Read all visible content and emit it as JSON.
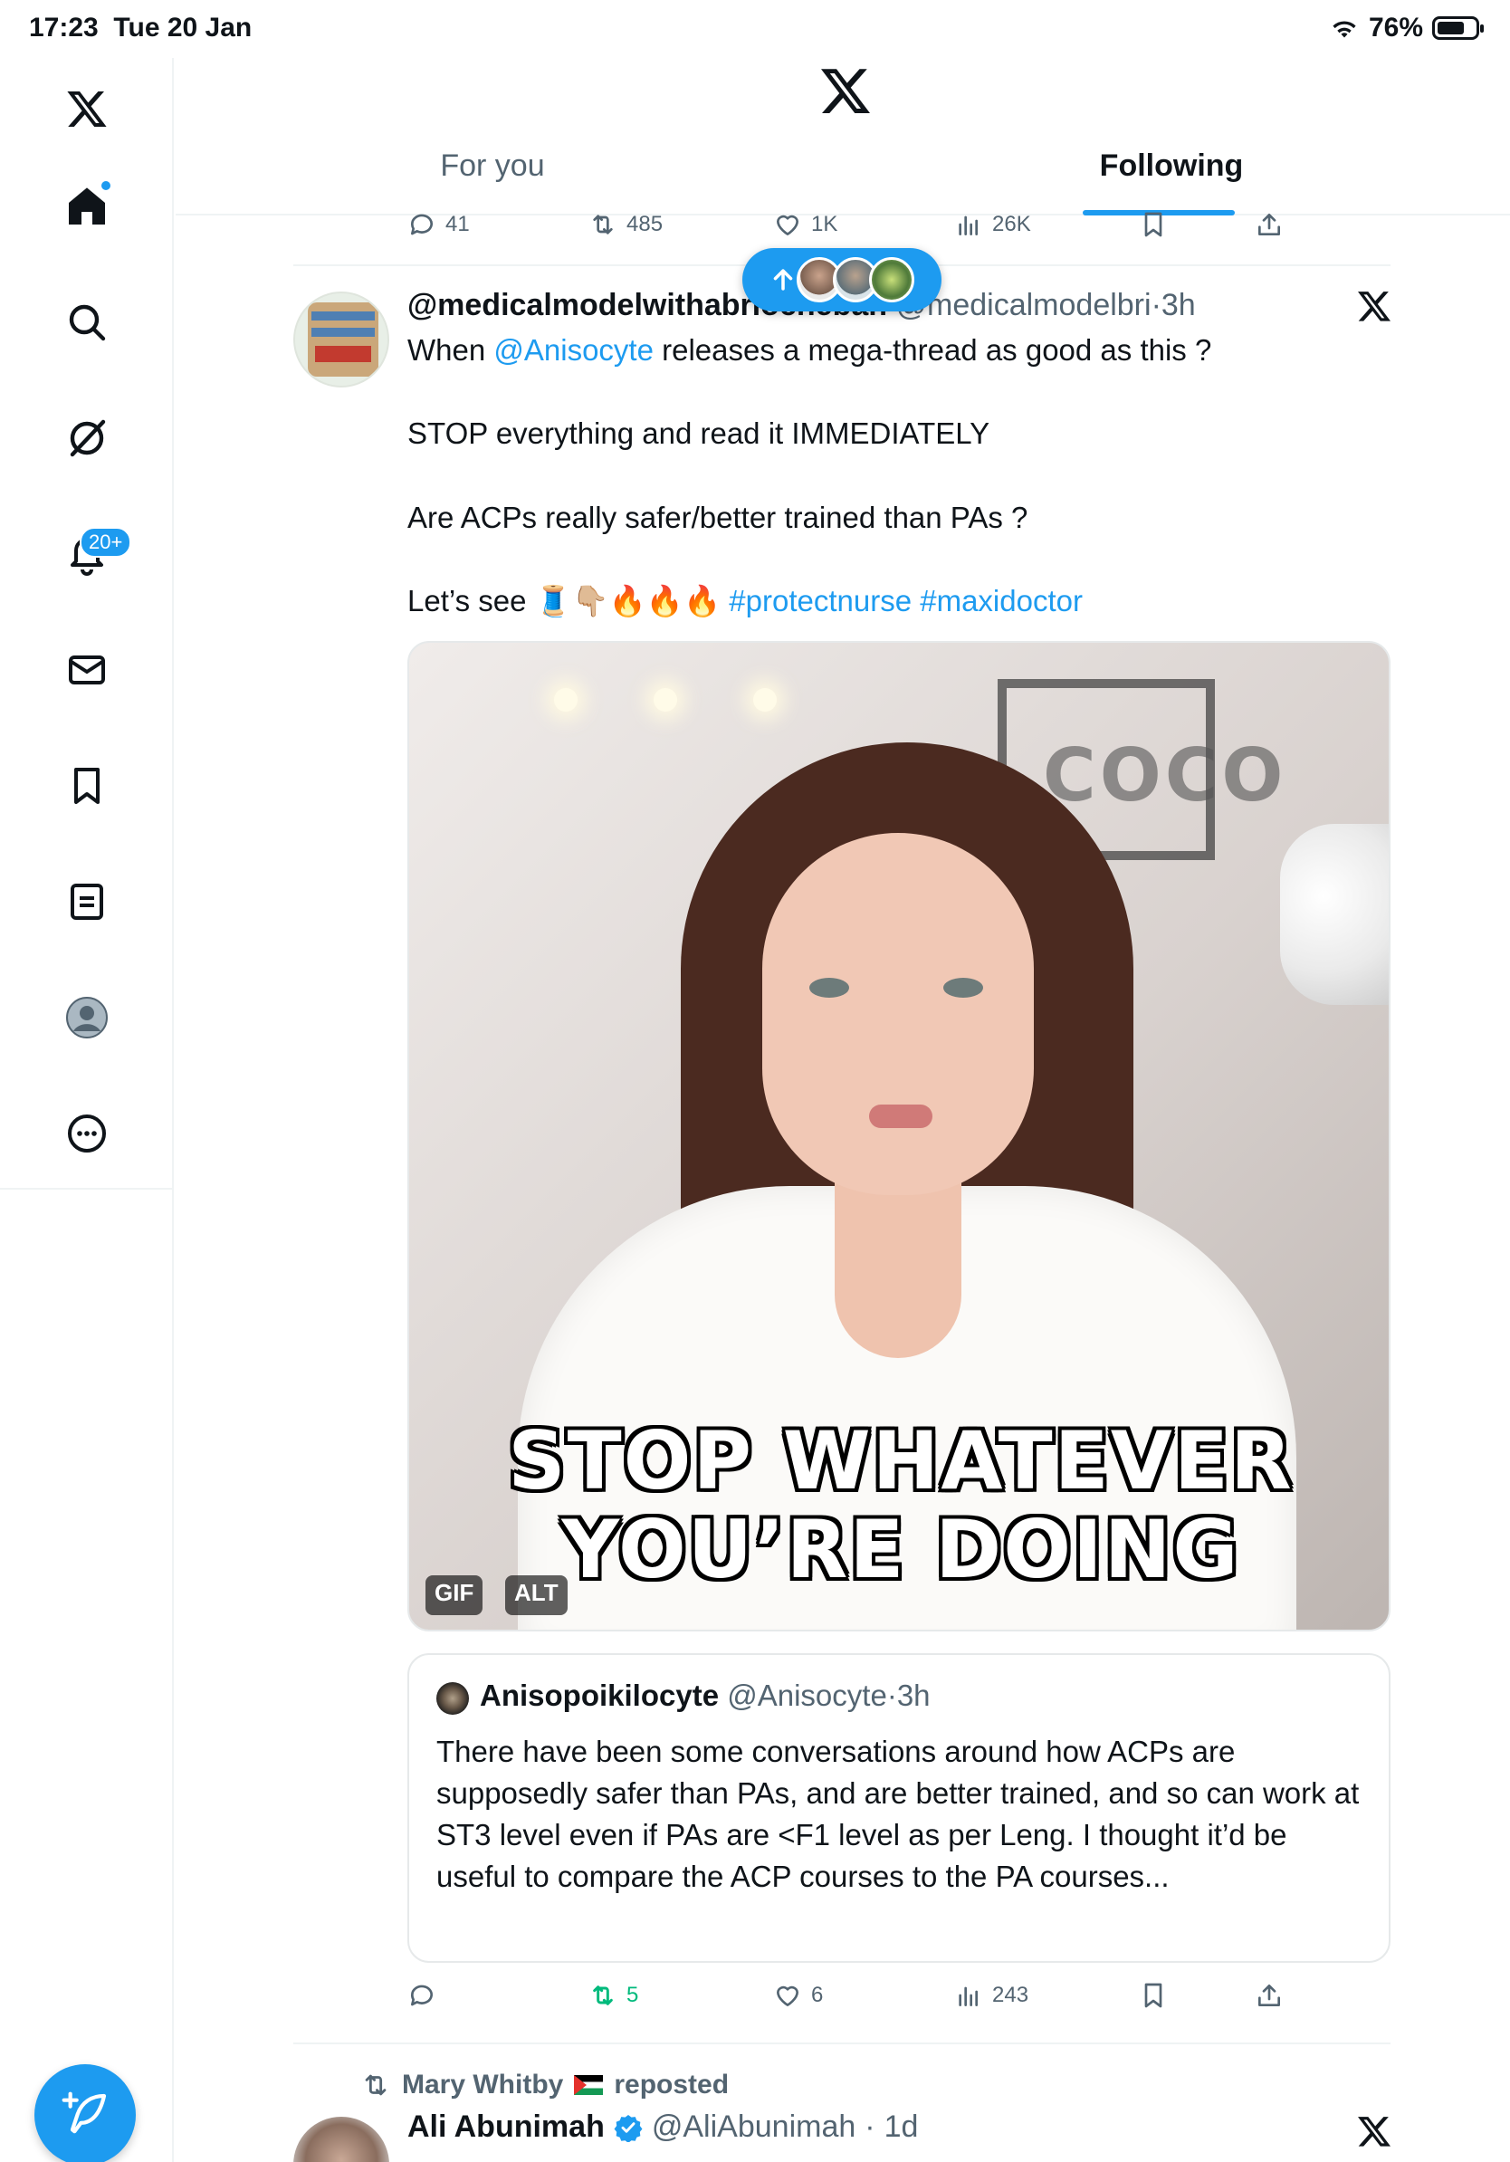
{
  "status_bar": {
    "time": "17:23",
    "date": "Tue 20 Jan",
    "battery": "76%"
  },
  "sidebar": {
    "items": [
      {
        "name": "x-logo-icon"
      },
      {
        "name": "home-icon"
      },
      {
        "name": "search-icon"
      },
      {
        "name": "grok-icon"
      },
      {
        "name": "notifications-icon",
        "badge": "20+"
      },
      {
        "name": "messages-icon"
      },
      {
        "name": "bookmarks-icon"
      },
      {
        "name": "lists-icon"
      },
      {
        "name": "profile-icon"
      },
      {
        "name": "more-icon"
      }
    ],
    "compose": "compose-post-icon"
  },
  "header": {
    "tabs": [
      {
        "label": "For you",
        "active": false
      },
      {
        "label": "Following",
        "active": true
      }
    ]
  },
  "top_actions": {
    "replies": "41",
    "reposts": "485",
    "likes": "1K",
    "views": "26K"
  },
  "tweet": {
    "display_name": "@medicalmodelwithabriocheban",
    "handle": "@medicalmodelbri",
    "time": "3h",
    "text_line1_pre": "When ",
    "mention": "@Anisocyte",
    "text_line1_post": " releases a mega-thread as good as this ?",
    "text_line2": "STOP everything and read it IMMEDIATELY",
    "text_line3": "Are ACPs really safer/better trained than PAs ?",
    "text_line4_pre": "Let’s see 🧵👇🏼🔥🔥🔥 ",
    "hashtag1": "#protectnurse",
    "hashtag2": "#maxidoctor",
    "media": {
      "caption_line1": "STOP WHATEVER",
      "caption_line2": "YOU’RE DOING",
      "background_word": "COCO",
      "tag_gif": "GIF",
      "tag_alt": "ALT"
    },
    "quote": {
      "display_name": "Anisopoikilocyte",
      "handle": "@Anisocyte",
      "time": "3h",
      "text": "There have been some conversations around how ACPs are supposedly safer than PAs, and are better trained, and so can work at ST3 level even if PAs are <F1 level as per Leng. I thought it’d be useful to compare the ACP courses to the PA courses..."
    },
    "actions": {
      "replies": "",
      "reposts": "5",
      "likes": "6",
      "views": "243"
    },
    "colors": {
      "repost_active": "#00ba7c",
      "link": "#1d9bf0"
    }
  },
  "next_tweet": {
    "reposted_by": "Mary Whitby",
    "reposted_label": "reposted",
    "display_name": "Ali Abunimah",
    "handle": "@AliAbunimah",
    "time": "1d"
  }
}
